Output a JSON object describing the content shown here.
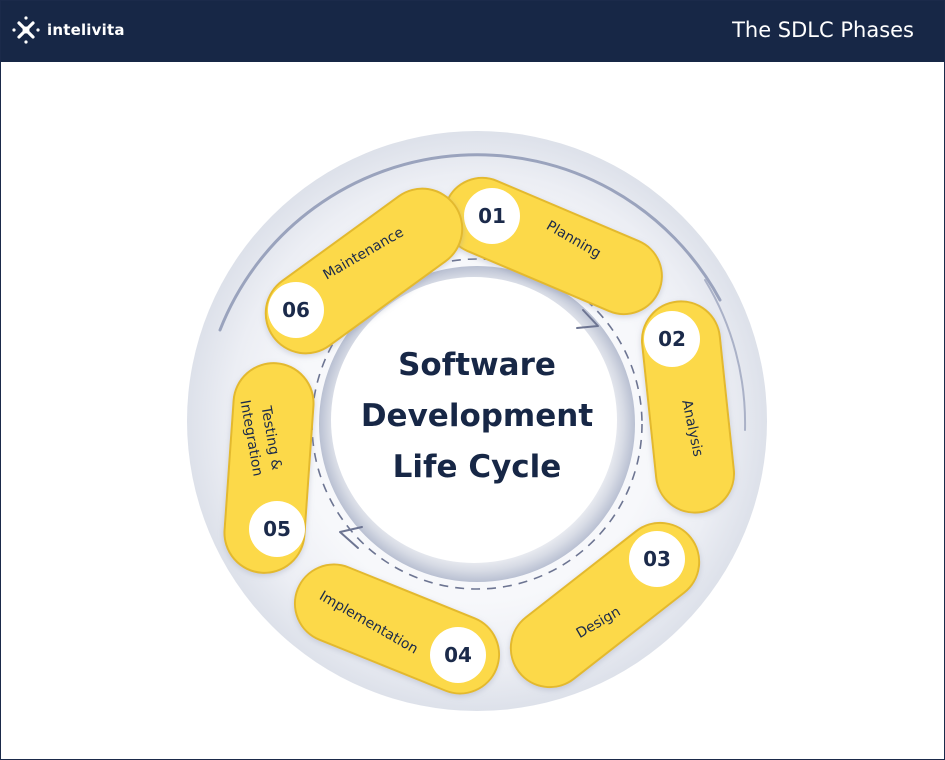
{
  "header": {
    "brand": "intelivita",
    "title": "The SDLC Phases"
  },
  "center": {
    "line1": "Software",
    "line2": "Development",
    "line3": "Life Cycle"
  },
  "phases": [
    {
      "number": "01",
      "label": "Planning"
    },
    {
      "number": "02",
      "label": "Analysis"
    },
    {
      "number": "03",
      "label": "Design"
    },
    {
      "number": "04",
      "label": "Implementation"
    },
    {
      "number": "05",
      "label_line1": "Testing &",
      "label_line2": "Integration"
    },
    {
      "number": "06",
      "label": "Maintenance"
    }
  ],
  "colors": {
    "header_bg": "#172746",
    "pill": "#fcd948",
    "pill_border": "#e3b92e",
    "ring": "#e9ebf1",
    "ring_edge": "#aab1c7",
    "text": "#172746"
  },
  "icons": [
    "logo-star-icon",
    "arrow-head-icon"
  ]
}
